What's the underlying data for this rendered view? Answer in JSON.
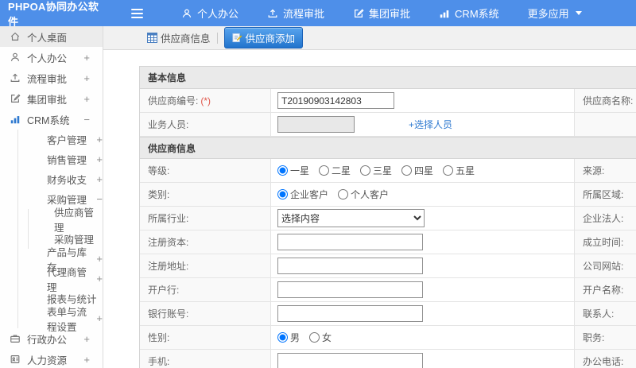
{
  "colors": {
    "topbar": "#4e8fe9",
    "accent_button": "#2173cc",
    "link": "#2f7ad0",
    "required": "#e0584c"
  },
  "app": {
    "title": "PHPOA协同办公软件"
  },
  "topnav": {
    "items": [
      {
        "label": "个人办公",
        "icon": "user-icon"
      },
      {
        "label": "流程审批",
        "icon": "flow-icon"
      },
      {
        "label": "集团审批",
        "icon": "edit-icon"
      },
      {
        "label": "CRM系统",
        "icon": "chart-icon"
      },
      {
        "label": "更多应用",
        "icon": "caret-down-icon"
      }
    ]
  },
  "sidebar": {
    "items": [
      {
        "label": "个人桌面",
        "icon": "home-icon",
        "active": true
      },
      {
        "label": "个人办公",
        "icon": "user-icon",
        "toggle": "+"
      },
      {
        "label": "流程审批",
        "icon": "flow-icon",
        "toggle": "+"
      },
      {
        "label": "集团审批",
        "icon": "edit-icon",
        "toggle": "+"
      },
      {
        "label": "CRM系统",
        "icon": "chart-icon",
        "toggle": "−"
      },
      {
        "label": "客户管理",
        "toggle": "+"
      },
      {
        "label": "销售管理",
        "toggle": "+"
      },
      {
        "label": "财务收支",
        "toggle": "+"
      },
      {
        "label": "采购管理",
        "toggle": "−"
      },
      {
        "label": "供应商管理"
      },
      {
        "label": "采购管理"
      },
      {
        "label": "产品与库存",
        "toggle": "+"
      },
      {
        "label": "代理商管理",
        "toggle": "+"
      },
      {
        "label": "报表与统计"
      },
      {
        "label": "表单与流程设置",
        "toggle": "+"
      },
      {
        "label": "行政办公",
        "icon": "briefcase-icon",
        "toggle": "+"
      },
      {
        "label": "人力资源",
        "icon": "hr-icon",
        "toggle": "+"
      }
    ]
  },
  "tabs": {
    "supplier_info": {
      "label": "供应商信息",
      "icon": "table-icon"
    },
    "supplier_add": {
      "label": "供应商添加",
      "icon": "form-pencil-icon",
      "active": true
    }
  },
  "form": {
    "sections": {
      "basic": "基本信息",
      "supplier": "供应商信息"
    },
    "rows": {
      "supplier_no": {
        "label": "供应商编号:",
        "req": "(*)",
        "value": "T20190903142803",
        "right_label": "供应商名称:",
        "right_req": "(*)"
      },
      "staff": {
        "label": "业务人员:",
        "value": "",
        "link": "+选择人员",
        "right_label": ""
      },
      "grade": {
        "label": "等级:",
        "options": [
          "一星",
          "二星",
          "三星",
          "四星",
          "五星"
        ],
        "checked": "一星",
        "right_label": "来源:"
      },
      "category": {
        "label": "类别:",
        "options": [
          "企业客户",
          "个人客户"
        ],
        "checked": "企业客户",
        "right_label": "所属区域:"
      },
      "industry": {
        "label": "所属行业:",
        "select_value": "选择内容",
        "right_label": "企业法人:"
      },
      "reg_capital": {
        "label": "注册资本:",
        "value": "",
        "right_label": "成立时间:"
      },
      "reg_address": {
        "label": "注册地址:",
        "value": "",
        "right_label": "公司网站:"
      },
      "bank": {
        "label": "开户行:",
        "value": "",
        "right_label": "开户名称:"
      },
      "bank_account": {
        "label": "银行账号:",
        "value": "",
        "right_label": "联系人:"
      },
      "gender": {
        "label": "性别:",
        "options": [
          "男",
          "女"
        ],
        "checked": "男",
        "right_label": "职务:"
      },
      "mobile": {
        "label": "手机:",
        "value": "",
        "right_label": "办公电话:"
      }
    }
  }
}
